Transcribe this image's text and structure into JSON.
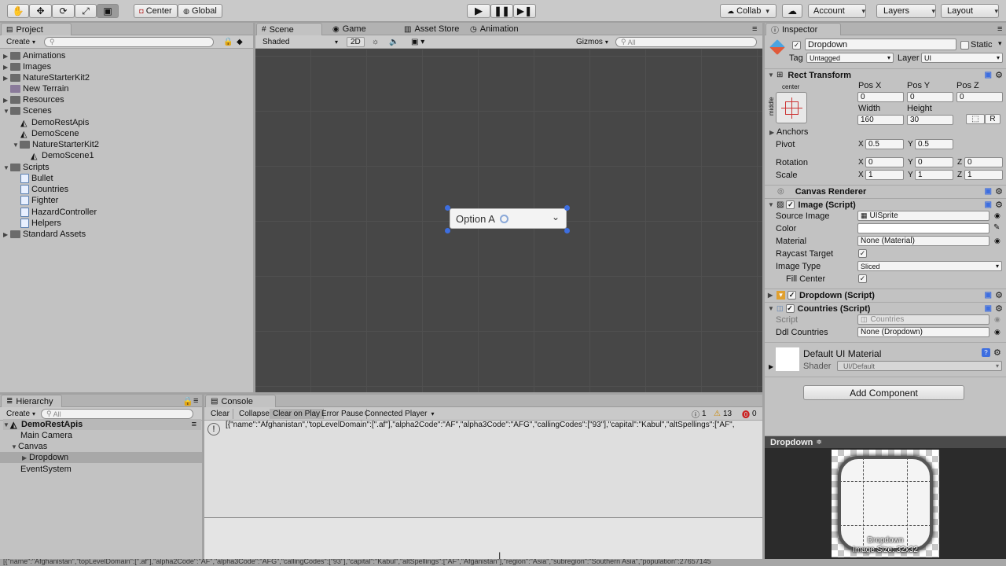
{
  "toolbar": {
    "center": "Center",
    "global": "Global",
    "collab": "Collab",
    "account": "Account",
    "layers": "Layers",
    "layout": "Layout"
  },
  "project": {
    "tab": "Project",
    "create": "Create",
    "items": [
      "Animations",
      "Images",
      "NatureStarterKit2",
      "New Terrain",
      "Resources",
      "Scenes",
      "DemoRestApis",
      "DemoScene",
      "NatureStarterKit2",
      "DemoScene1",
      "Scripts",
      "Bullet",
      "Countries",
      "Fighter",
      "HazardController",
      "Helpers",
      "Standard Assets"
    ]
  },
  "scene": {
    "tabs": [
      "Scene",
      "Game",
      "Asset Store",
      "Animation"
    ],
    "shaded": "Shaded",
    "mode2d": "2D",
    "gizmos": "Gizmos",
    "search": "All",
    "dropdown_label": "Option A"
  },
  "inspector": {
    "tab": "Inspector",
    "object_name": "Dropdown",
    "static": "Static",
    "tag_label": "Tag",
    "tag": "Untagged",
    "layer_label": "Layer",
    "layer": "UI",
    "rect": {
      "title": "Rect Transform",
      "center": "center",
      "middle": "middle",
      "posx": "Pos X",
      "posy": "Pos Y",
      "posz": "Pos Z",
      "px": "0",
      "py": "0",
      "pz": "0",
      "width": "Width",
      "height": "Height",
      "w": "160",
      "h": "30",
      "r": "R",
      "anchors": "Anchors",
      "pivot": "Pivot",
      "pivot_x": "0.5",
      "pivot_y": "0.5",
      "rotation": "Rotation",
      "rot_x": "0",
      "rot_y": "0",
      "rot_z": "0",
      "scale": "Scale",
      "sc_x": "1",
      "sc_y": "1",
      "sc_z": "1",
      "x": "X",
      "y": "Y",
      "z": "Z"
    },
    "canvas_renderer": "Canvas Renderer",
    "image": {
      "title": "Image (Script)",
      "source_image": "Source Image",
      "source_val": "UISprite",
      "color": "Color",
      "material": "Material",
      "material_val": "None (Material)",
      "raycast": "Raycast Target",
      "image_type": "Image Type",
      "type_val": "Sliced",
      "fill_center": "Fill Center"
    },
    "dropdown_script": "Dropdown (Script)",
    "countries": {
      "title": "Countries (Script)",
      "script": "Script",
      "script_val": "Countries",
      "ddl": "Ddl Countries",
      "ddl_val": "None (Dropdown)"
    },
    "material": {
      "title": "Default UI Material",
      "shader": "Shader",
      "shader_val": "UI/Default"
    },
    "add_component": "Add Component"
  },
  "hierarchy": {
    "tab": "Hierarchy",
    "create": "Create",
    "search": "All",
    "items": [
      "DemoRestApis",
      "Main Camera",
      "Canvas",
      "Dropdown",
      "EventSystem"
    ]
  },
  "console": {
    "tab": "Console",
    "buttons": [
      "Clear",
      "Collapse",
      "Clear on Play",
      "Error Pause",
      "Connected Player"
    ],
    "count_warn": "1",
    "count_log": "13",
    "count_err": "0",
    "message": "[{\"name\":\"Afghanistan\",\"topLevelDomain\":[\".af\"],\"alpha2Code\":\"AF\",\"alpha3Code\":\"AFG\",\"callingCodes\":[\"93\"],\"capital\":\"Kabul\",\"altSpellings\":[\"AF\","
  },
  "preview": {
    "title": "Dropdown",
    "caption1": "Dropdown",
    "caption2": "Image Size: 32x32"
  },
  "statusbar": {
    "text": "[{\"name\":\"Afghanistan\",\"topLevelDomain\":[\".af\"],\"alpha2Code\":\"AF\",\"alpha3Code\":\"AFG\",\"callingCodes\":[\"93\"],\"capital\":\"Kabul\",\"altSpellings\":[\"AF\",\"Afġānistān\"],\"region\":\"Asia\",\"subregion\":\"Southern Asia\",\"population\":27657145"
  }
}
